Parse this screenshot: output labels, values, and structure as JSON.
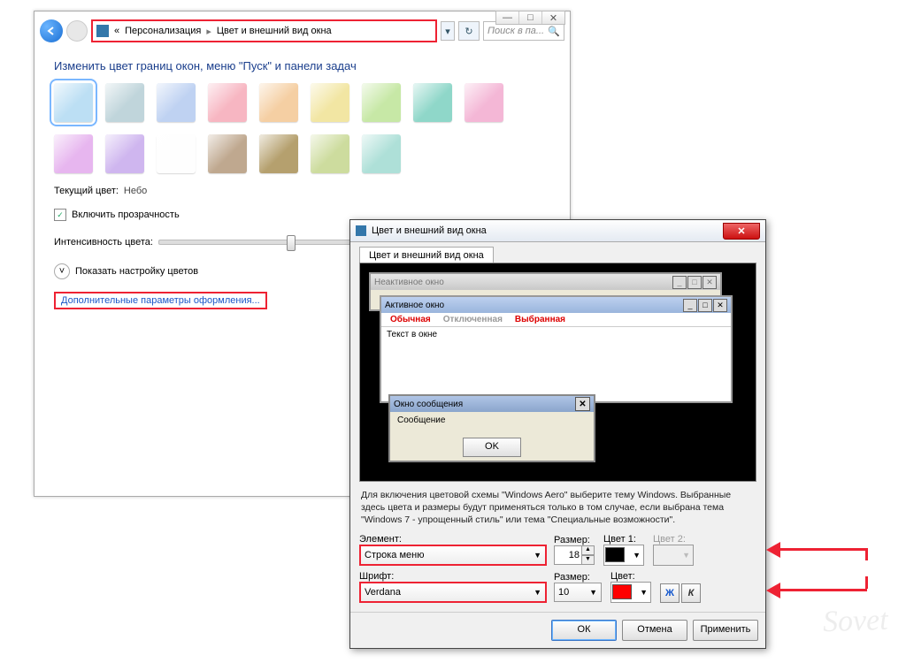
{
  "window_controls": {
    "min": "—",
    "max": "□",
    "close": "✕"
  },
  "breadcrumb": {
    "chev": "«",
    "item1": "Персонализация",
    "sep": "▸",
    "item2": "Цвет и внешний вид окна"
  },
  "search_placeholder": "Поиск в па...",
  "heading": "Изменить цвет границ окон, меню \"Пуск\" и панели задач",
  "swatch_colors": [
    "#bcdff4",
    "#c0d5db",
    "#bfd2f2",
    "#f7b6c2",
    "#f5cfa3",
    "#f2e6a3",
    "#c7e8a6",
    "#8fd7c9",
    "#f4b7d6",
    "#e7b6ef",
    "#cfb6ef",
    "#fefefe",
    "#bfa88f",
    "#b5a06e",
    "#cddc9e",
    "#aee0d8"
  ],
  "current_label": "Текущий цвет:",
  "current_value": "Небо",
  "transparency_label": "Включить прозрачность",
  "intensity_label": "Интенсивность цвета:",
  "show_mixer_label": "Показать настройку цветов",
  "advanced_link": "Дополнительные параметры оформления...",
  "dialog": {
    "title": "Цвет и внешний вид окна",
    "tab": "Цвет и внешний вид окна",
    "inactive": "Неактивное окно",
    "active": "Активное окно",
    "menu_normal": "Обычная",
    "menu_disabled": "Отключенная",
    "menu_selected": "Выбранная",
    "text_in_window": "Текст в окне",
    "msg_title": "Окно сообщения",
    "msg_body": "Сообщение",
    "ok": "OK",
    "desc": "Для включения цветовой схемы \"Windows Aero\" выберите тему Windows. Выбранные здесь цвета и размеры будут применяться только в том случае, если выбрана тема \"Windows 7 - упрощенный стиль\" или тема \"Специальные возможности\".",
    "element_label": "Элемент:",
    "element_value": "Строка меню",
    "size_label": "Размер:",
    "size_value": "18",
    "color1_label": "Цвет 1:",
    "color2_label": "Цвет 2:",
    "font_label": "Шрифт:",
    "font_value": "Verdana",
    "font_size_label": "Размер:",
    "font_size_value": "10",
    "font_color_label": "Цвет:",
    "bold": "Ж",
    "italic": "К",
    "btn_ok": "ОК",
    "btn_cancel": "Отмена",
    "btn_apply": "Применить"
  },
  "watermark": "Sovet"
}
